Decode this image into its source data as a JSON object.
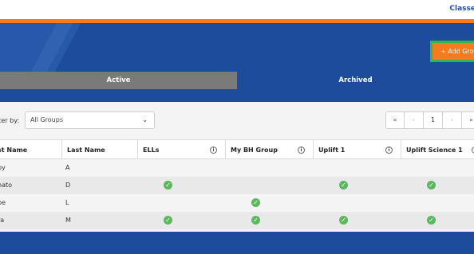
{
  "top_link": "Classe",
  "add_button_label": "+ Add Grou",
  "tabs": [
    {
      "label": "Active",
      "selected": true
    },
    {
      "label": "Archived",
      "selected": false
    }
  ],
  "filter": {
    "label": "lter by:",
    "value": "All Groups"
  },
  "pager": {
    "first": "«",
    "prev": "‹",
    "page": "1",
    "next": "›",
    "last": "»"
  },
  "columns": [
    "st Name",
    "Last Name",
    "ELLs",
    "My BH Group",
    "Uplift 1",
    "Uplift Science 1"
  ],
  "rows": [
    {
      "first": "by",
      "last": "A",
      "ells": false,
      "bh": false,
      "uplift1": false,
      "science": false
    },
    {
      "first": "nato",
      "last": "D",
      "ells": true,
      "bh": false,
      "uplift1": true,
      "science": true
    },
    {
      "first": "be",
      "last": "L",
      "ells": false,
      "bh": true,
      "uplift1": false,
      "science": false
    },
    {
      "first": "ra",
      "last": "M",
      "ells": true,
      "bh": true,
      "uplift1": true,
      "science": true
    }
  ],
  "colors": {
    "brand_blue": "#1d4c9c",
    "orange": "#f47b20",
    "green": "#38b54a",
    "check": "#5cb85c"
  }
}
